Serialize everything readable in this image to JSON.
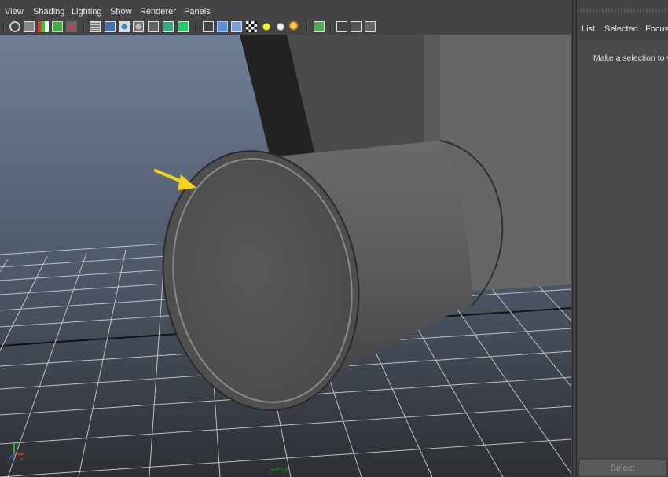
{
  "menubar": {
    "items": [
      {
        "label": "View"
      },
      {
        "label": "Shading"
      },
      {
        "label": "Lighting"
      },
      {
        "label": "Show"
      },
      {
        "label": "Renderer"
      },
      {
        "label": "Panels"
      }
    ]
  },
  "toolbar": {
    "icons": [
      "select-camera-icon",
      "lock-camera-icon",
      "camera-attributes-icon",
      "bookmarks-icon",
      "image-plane-icon",
      "grid-icon",
      "film-gate-icon",
      "resolution-gate-icon",
      "gate-mask-icon",
      "field-chart-icon",
      "safe-action-icon",
      "safe-title-icon",
      "wireframe-icon",
      "smooth-shade-icon",
      "wireframe-on-shaded-icon",
      "textured-icon",
      "use-all-lights-icon",
      "shadows-icon",
      "ambient-occlusion-icon",
      "isolate-select-icon",
      "xray-icon",
      "xray-joints-icon",
      "xray-components-icon"
    ]
  },
  "viewport": {
    "camera_label": "persp",
    "annotation_color": "#f2d21b",
    "axis_labels": {
      "y": "y",
      "x": "x"
    }
  },
  "right_panel": {
    "tabs": [
      {
        "label": "List"
      },
      {
        "label": "Selected"
      },
      {
        "label": "Focus"
      }
    ],
    "message": "Make a selection to v",
    "select_label": "Select"
  }
}
